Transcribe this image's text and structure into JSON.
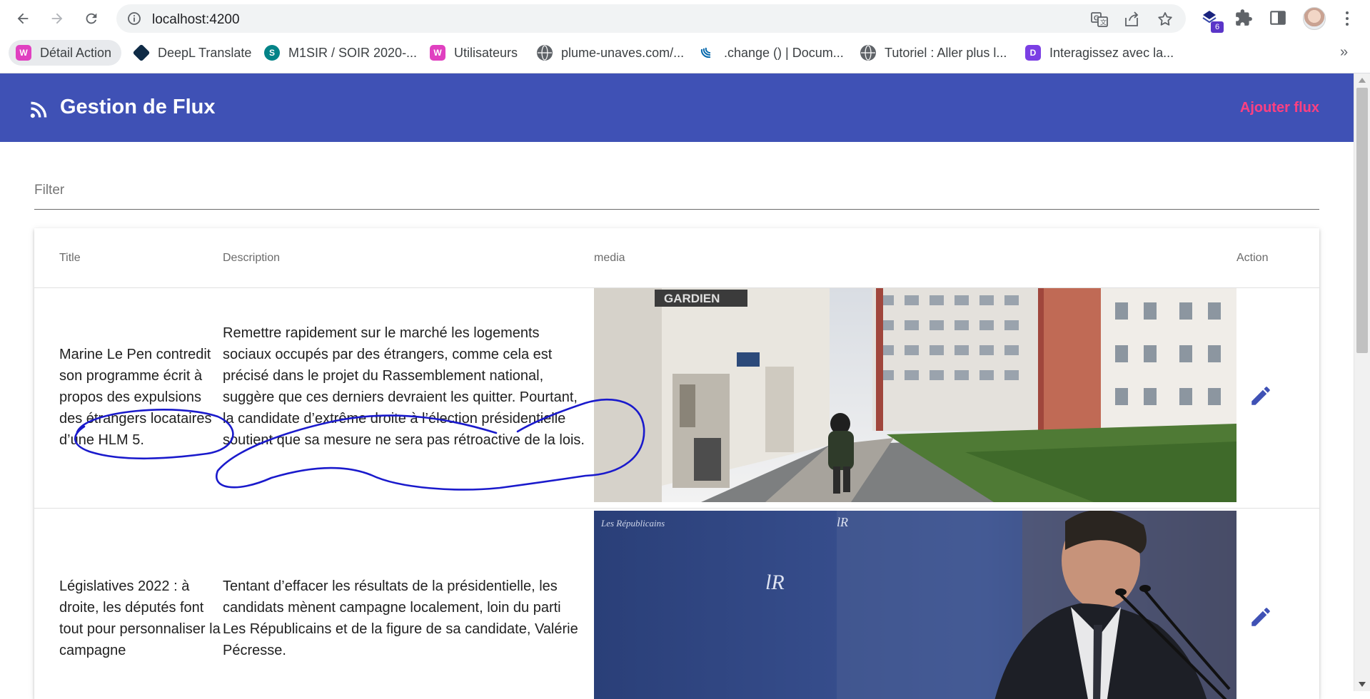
{
  "browser": {
    "url": "localhost:4200",
    "extension_badge": "6",
    "bookmarks": [
      {
        "label": "Détail Action",
        "icon": "webflow-w-icon",
        "color": "#e040c0"
      },
      {
        "label": "DeepL Translate",
        "icon": "deepl-icon",
        "color": "#0f2b46"
      },
      {
        "label": "M1SIR / SOIR 2020-...",
        "icon": "sharepoint-icon",
        "color": "#038387"
      },
      {
        "label": "Utilisateurs",
        "icon": "webflow-w-icon",
        "color": "#e040c0"
      },
      {
        "label": "plume-unaves.com/...",
        "icon": "globe-icon",
        "color": "#5f6368"
      },
      {
        "label": ".change () | Docum...",
        "icon": "jquery-icon",
        "color": "#0769ad"
      },
      {
        "label": "Tutoriel : Aller plus l...",
        "icon": "globe-icon",
        "color": "#5f6368"
      },
      {
        "label": "Interagissez avec la...",
        "icon": "purple-d-icon",
        "color": "#7b3fe4"
      }
    ],
    "more_bookmarks": "»"
  },
  "appbar": {
    "icon": "rss-feed-icon",
    "title": "Gestion de Flux",
    "add_button": "Ajouter flux",
    "background": "#3f51b5",
    "accent": "#ff4081"
  },
  "filter": {
    "placeholder": "Filter",
    "value": ""
  },
  "table": {
    "columns": [
      "Title",
      "Description",
      "media",
      "Action"
    ],
    "rows": [
      {
        "title": "Marine Le Pen contredit son programme écrit à propos des expulsions des étrangers locataires d’une HLM 5.",
        "description": "Remettre rapidement sur le marché les logements sociaux occupés par des étrangers, comme cela est précisé dans le projet du Rassemblement national, suggère que ces derniers devraient les quitter. Pourtant, la candidate d’extrême droite à l’élection présidentielle soutient que sa mesure ne sera pas rétroactive de la lois.",
        "media_alt": "Cour d'immeubles HLM avec piéton",
        "sign_text": "GARDIEN",
        "action_icon": "edit-pencil-icon"
      },
      {
        "title": "Législatives 2022 : à droite, les députés font tout pour personnaliser la campagne",
        "description": "Tentant d’effacer les résultats de la présidentielle, les candidats mènent campagne localement, loin du parti Les Républicains et de la figure de sa candidate, Valérie Pécresse.",
        "media_alt": "Homme au pupitre devant le logo Les Républicains",
        "backdrop_text": "Les Républicains",
        "action_icon": "edit-pencil-icon"
      }
    ]
  }
}
